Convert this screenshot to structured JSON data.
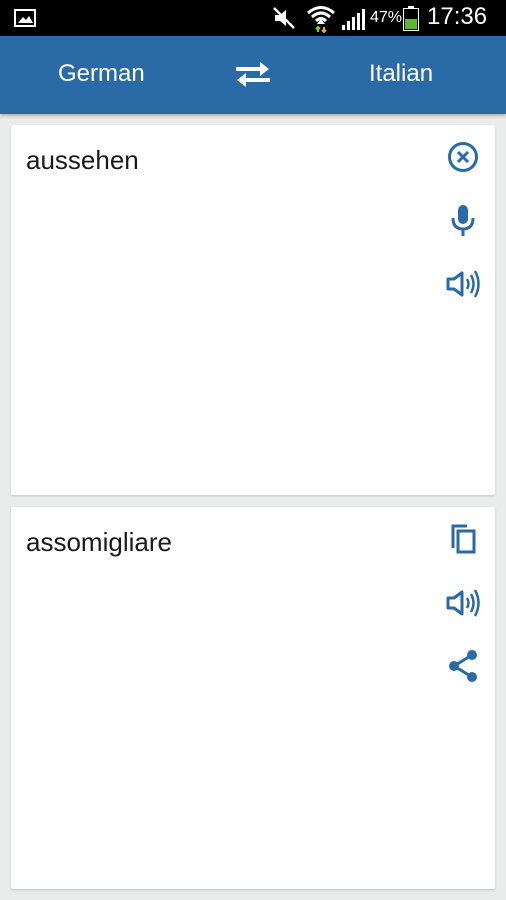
{
  "status_bar": {
    "battery": "47%",
    "time": "17:36"
  },
  "toolbar": {
    "source_language": "German",
    "target_language": "Italian"
  },
  "input_card": {
    "text": "aussehen"
  },
  "output_card": {
    "text": "assomigliare"
  },
  "icons": {
    "status": [
      "gallery-icon",
      "mute-icon",
      "wifi-icon",
      "signal-icon",
      "battery-icon"
    ],
    "toolbar": [
      "swap-icon"
    ],
    "input_card": [
      "clear-icon",
      "microphone-icon",
      "speaker-icon"
    ],
    "output_card": [
      "copy-icon",
      "speaker-icon",
      "share-icon"
    ]
  },
  "colors": {
    "toolbar": "#2a6aa6",
    "accent": "#2a6aa6",
    "background": "#e9eceb"
  }
}
